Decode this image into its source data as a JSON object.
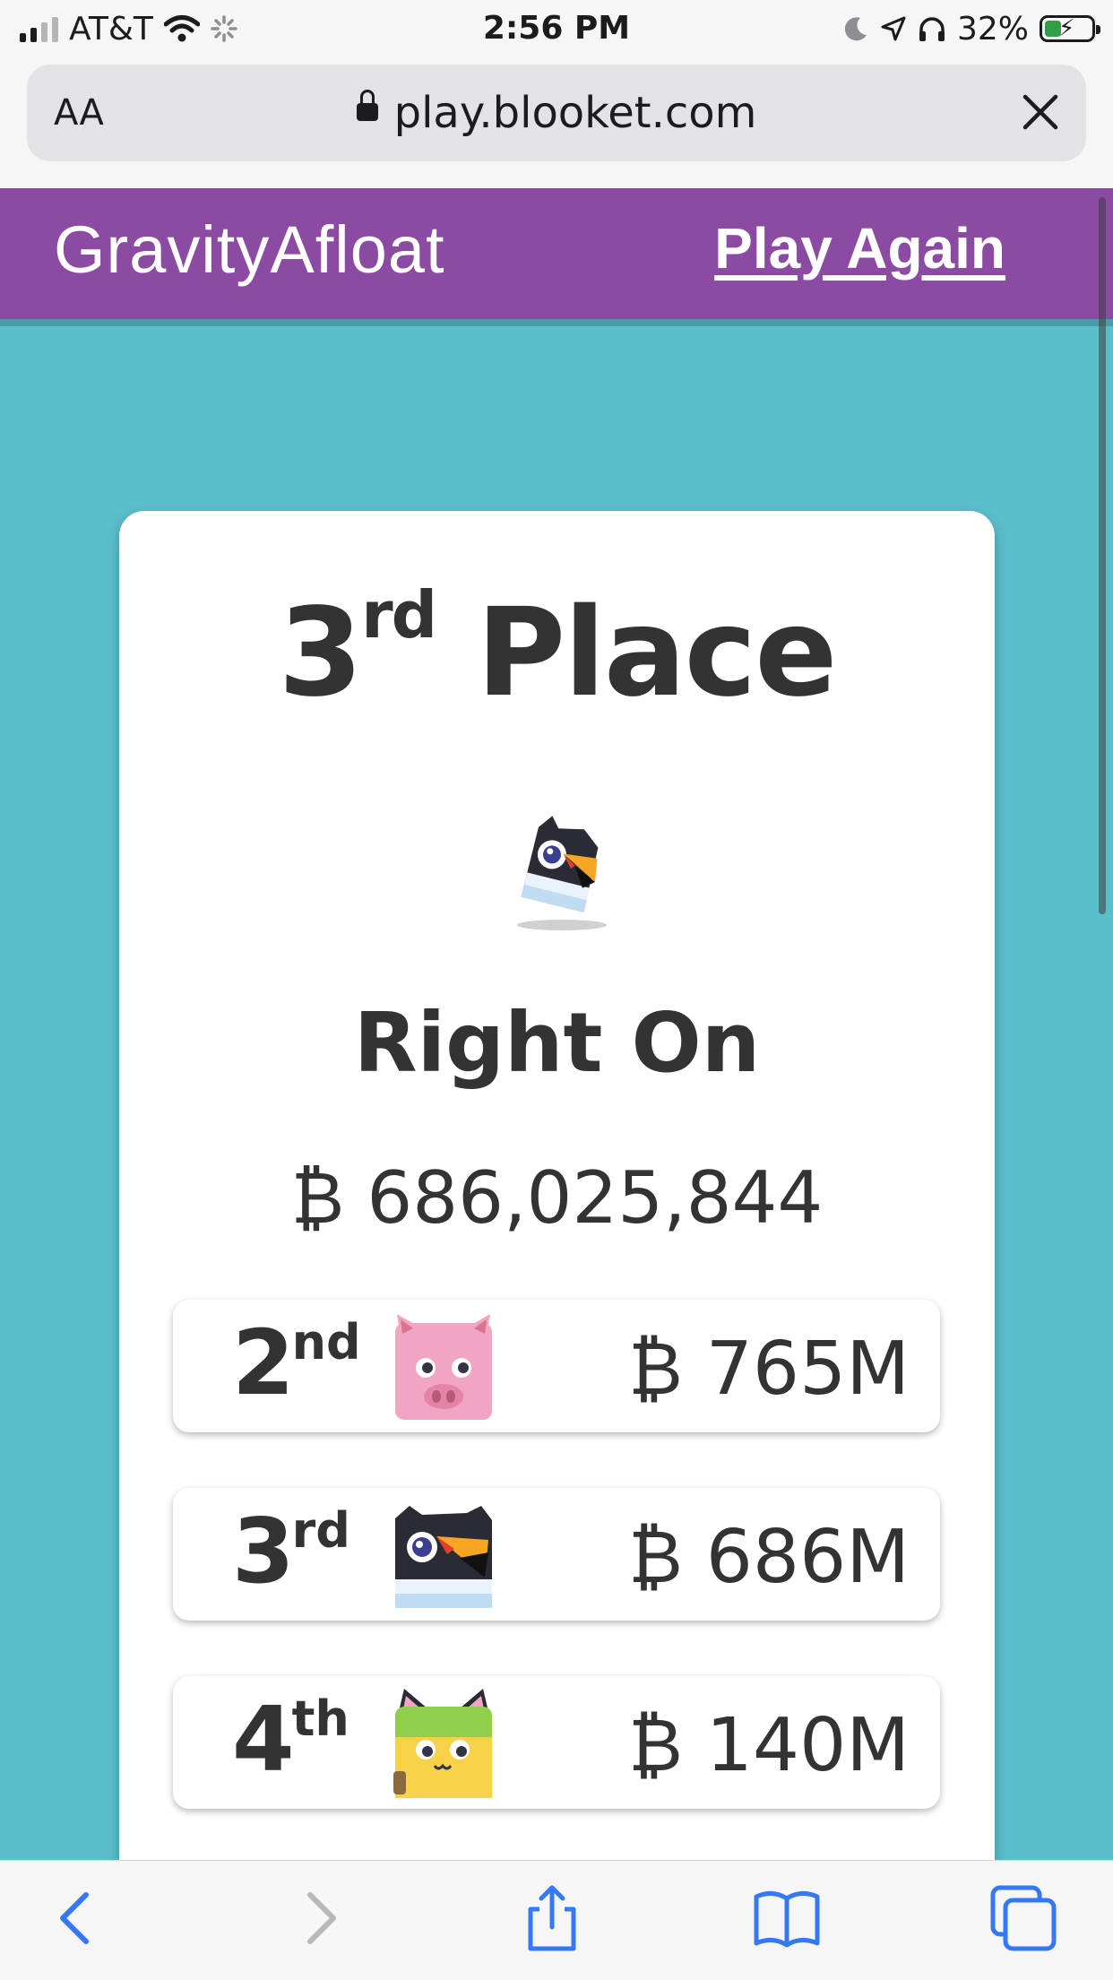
{
  "status_bar": {
    "carrier": "AT&T",
    "time": "2:56 PM",
    "battery": "32%"
  },
  "browser": {
    "text_size_label": "AA",
    "url": "play.blooket.com"
  },
  "header": {
    "game_name": "GravityAfloat",
    "play_again_label": "Play Again"
  },
  "result": {
    "place_number": "3",
    "place_suffix": "rd",
    "place_word": "Place",
    "player_name": "Right On",
    "score": "₿ 686,025,844"
  },
  "leaderboard": [
    {
      "number": "2",
      "suffix": "nd",
      "amount": "₿ 765M",
      "icon": "pig-blook-icon"
    },
    {
      "number": "3",
      "suffix": "rd",
      "amount": "₿ 686M",
      "icon": "toucan-blook-icon"
    },
    {
      "number": "4",
      "suffix": "th",
      "amount": "₿ 140M",
      "icon": "cat-blook-icon"
    }
  ],
  "colors": {
    "header_purple": "#8c4ba3",
    "background_teal": "#5bbecb",
    "card_white": "#ffffff",
    "text_dark": "#333333",
    "ios_blue": "#3478f6"
  }
}
